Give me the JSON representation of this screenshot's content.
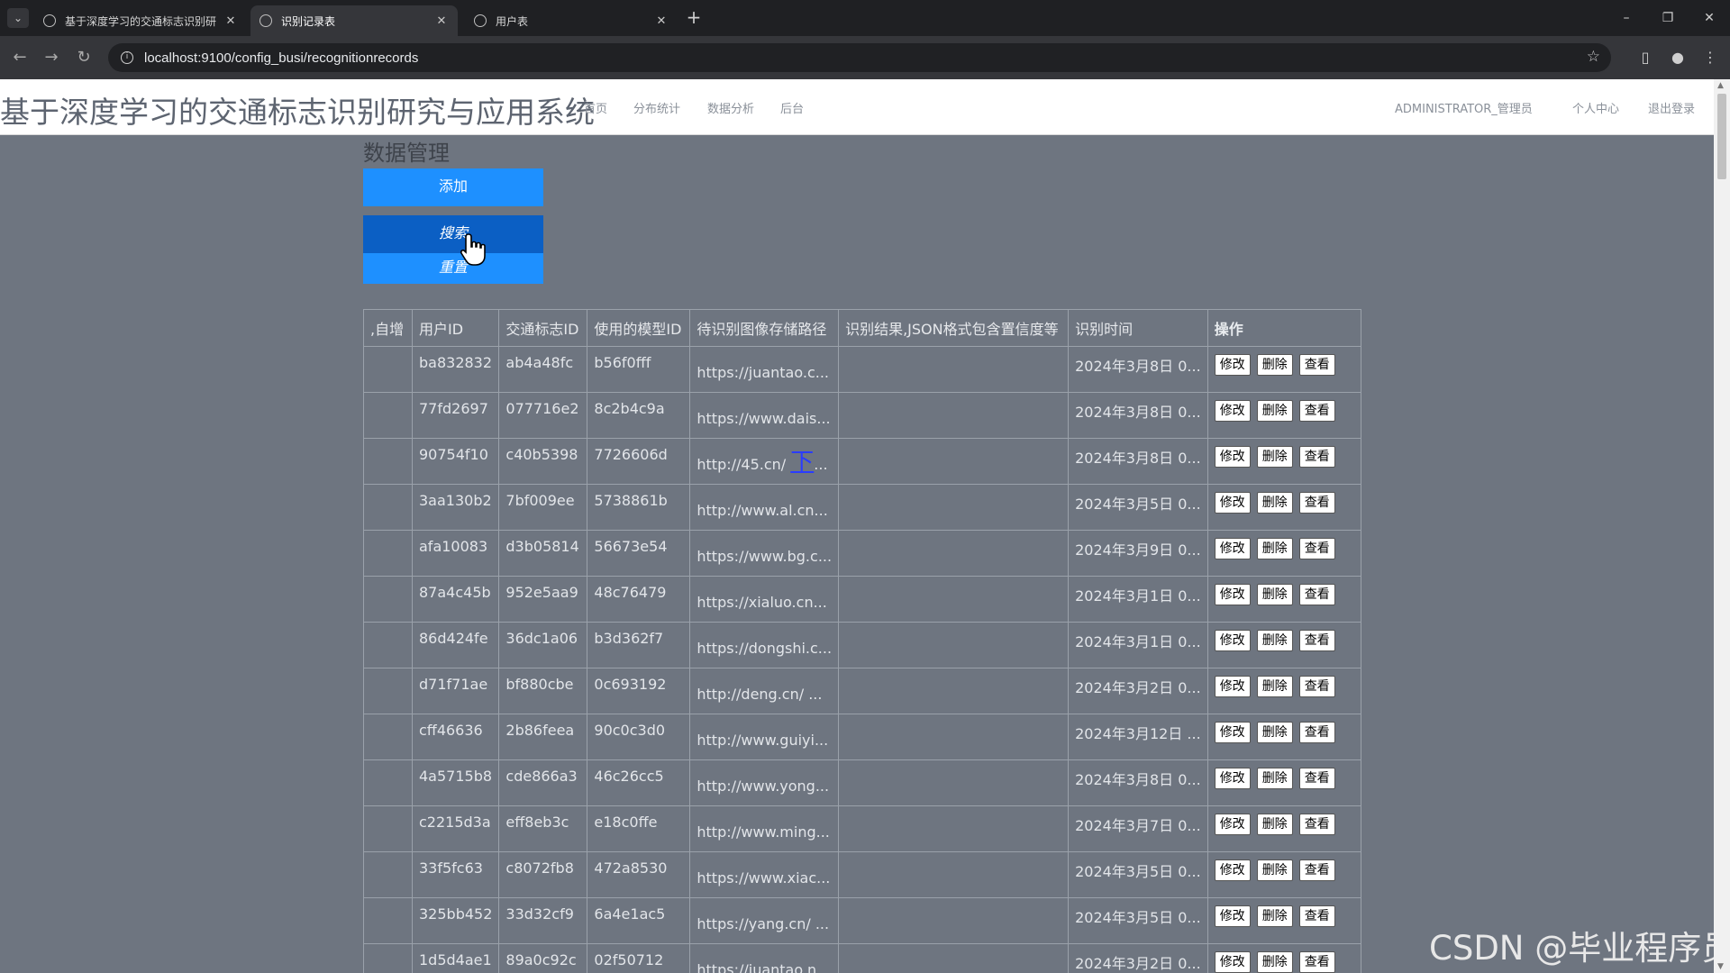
{
  "browser": {
    "tabs": [
      {
        "title": "基于深度学习的交通标志识别研",
        "active": false
      },
      {
        "title": "识别记录表",
        "active": true
      },
      {
        "title": "用户表",
        "active": false
      }
    ],
    "url": "localhost:9100/config_busi/recognitionrecords"
  },
  "header": {
    "site_title": "基于深度学习的交通标志识别研究与应用系统",
    "nav": [
      "首页",
      "分布统计",
      "数据分析",
      "后台"
    ],
    "user_name": "ADMINISTRATOR_管理员",
    "profile": "个人中心",
    "logout": "退出登录"
  },
  "main": {
    "section_title": "数据管理",
    "add_label": "添加",
    "search_label": "搜索",
    "reset_label": "重置"
  },
  "table": {
    "headers": [
      ",自增",
      "用户ID",
      "交通标志ID",
      "使用的模型ID",
      "待识别图像存储路径",
      "识别结果,JSON格式包含置信度等",
      "识别时间",
      "操作"
    ],
    "actions": [
      "修改",
      "删除",
      "查看"
    ],
    "rows": [
      {
        "id": "",
        "user": "ba832832",
        "sign": "ab4a48fc",
        "model": "b56f0fff",
        "path": "https://juantao.c...",
        "result": "",
        "time": "2024年3月8日 0..."
      },
      {
        "id": "",
        "user": "77fd2697",
        "sign": "077716e2",
        "model": "8c2b4c9a",
        "path": "https://www.dais...",
        "result": "",
        "time": "2024年3月8日 0..."
      },
      {
        "id": "",
        "user": "90754f10",
        "sign": "c40b5398",
        "model": "7726606d",
        "path": "http://45.cn/ ",
        "path_link": "下",
        "path_tail": "...",
        "result": "",
        "time": "2024年3月8日 0..."
      },
      {
        "id": "",
        "user": "3aa130b2",
        "sign": "7bf009ee",
        "model": "5738861b",
        "path": "http://www.al.cn...",
        "result": "",
        "time": "2024年3月5日 0..."
      },
      {
        "id": "",
        "user": "afa10083",
        "sign": "d3b05814",
        "model": "56673e54",
        "path": "https://www.bg.c...",
        "result": "",
        "time": "2024年3月9日 0..."
      },
      {
        "id": "",
        "user": "87a4c45b",
        "sign": "952e5aa9",
        "model": "48c76479",
        "path": "https://xialuo.cn...",
        "result": "",
        "time": "2024年3月1日 0..."
      },
      {
        "id": "",
        "user": "86d424fe",
        "sign": "36dc1a06",
        "model": "b3d362f7",
        "path": "https://dongshi.c...",
        "result": "",
        "time": "2024年3月1日 0..."
      },
      {
        "id": "",
        "user": "d71f71ae",
        "sign": "bf880cbe",
        "model": "0c693192",
        "path": "http://deng.cn/ ...",
        "result": "",
        "time": "2024年3月2日 0..."
      },
      {
        "id": "",
        "user": "cff46636",
        "sign": "2b86feea",
        "model": "90c0c3d0",
        "path": "http://www.guiyi...",
        "result": "",
        "time": "2024年3月12日 ..."
      },
      {
        "id": "",
        "user": "4a5715b8",
        "sign": "cde866a3",
        "model": "46c26cc5",
        "path": "http://www.yong...",
        "result": "",
        "time": "2024年3月8日 0..."
      },
      {
        "id": "",
        "user": "c2215d3a",
        "sign": "eff8eb3c",
        "model": "e18c0ffe",
        "path": "http://www.ming...",
        "result": "",
        "time": "2024年3月7日 0..."
      },
      {
        "id": "",
        "user": "33f5fc63",
        "sign": "c8072fb8",
        "model": "472a8530",
        "path": "https://www.xiac...",
        "result": "",
        "time": "2024年3月5日 0..."
      },
      {
        "id": "",
        "user": "325bb452",
        "sign": "33d32cf9",
        "model": "6a4e1ac5",
        "path": "https://yang.cn/ ...",
        "result": "",
        "time": "2024年3月5日 0..."
      },
      {
        "id": "",
        "user": "1d5d4ae1",
        "sign": "89a0c92c",
        "model": "02f50712",
        "path": "https://juantao.n...",
        "result": "",
        "time": "2024年3月2日 0..."
      }
    ]
  },
  "watermark": "CSDN @毕业程序员",
  "colors": {
    "page_bg": "#6e7580",
    "primary_button": "#1e90ff",
    "pressed_button": "#0b5fc4",
    "header_bg": "#ffffff"
  }
}
